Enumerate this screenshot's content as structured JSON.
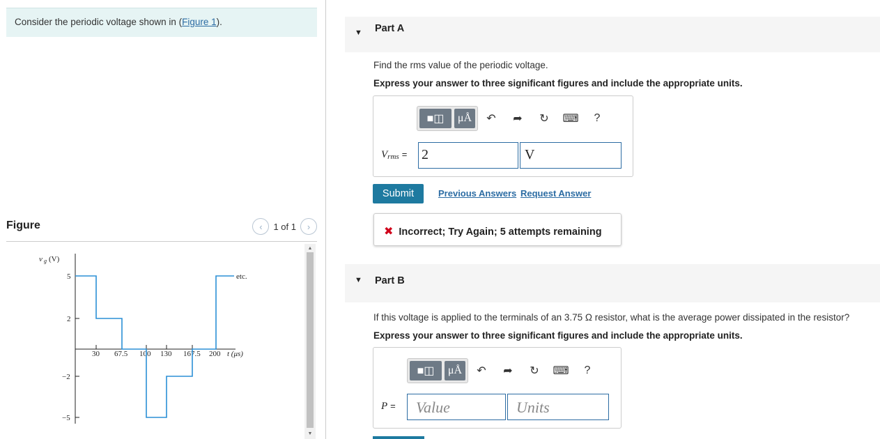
{
  "intro": {
    "text_before": "Consider the periodic voltage shown in ",
    "link": "Figure 1",
    "text_after": "."
  },
  "figure": {
    "title": "Figure",
    "pager": "1 of 1",
    "y_axis_label": "vg (V)",
    "y_ticks": [
      "5",
      "2",
      "−2",
      "−5"
    ],
    "x_ticks": [
      "30",
      "67.5",
      "100",
      "130",
      "167.5",
      "200"
    ],
    "x_axis_label": "t (μs)",
    "annotation": "etc."
  },
  "chart_data": {
    "type": "line",
    "xlabel": "t (μs)",
    "ylabel": "vg (V)",
    "x": [
      0,
      30,
      30,
      67.5,
      67.5,
      100,
      100,
      130,
      130,
      167.5,
      167.5,
      200,
      200,
      230
    ],
    "y": [
      5,
      5,
      2,
      2,
      0,
      0,
      -5,
      -5,
      -2,
      -2,
      0,
      0,
      5,
      5
    ],
    "annotation": "etc.",
    "ylim": [
      -5,
      5
    ]
  },
  "partA": {
    "label": "Part A",
    "question": "Find the rms value of the periodic voltage.",
    "instruction": "Express your answer to three significant figures and include the appropriate units.",
    "field_var": "V",
    "field_sub": "rms",
    "field_eq": "=",
    "value": "2",
    "units": "V",
    "submit": "Submit",
    "previous": "Previous Answers",
    "request": "Request Answer",
    "feedback": "Incorrect; Try Again; 5 attempts remaining"
  },
  "partB": {
    "label": "Part B",
    "question": "If this voltage is applied to the terminals of an 3.75 Ω resistor, what is the average power dissipated in the resistor?",
    "instruction": "Express your answer to three significant figures and include the appropriate units.",
    "field_var": "P",
    "field_eq": "=",
    "value_placeholder": "Value",
    "units_placeholder": "Units"
  },
  "toolbar": {
    "units_btn": "μÅ",
    "help": "?"
  }
}
